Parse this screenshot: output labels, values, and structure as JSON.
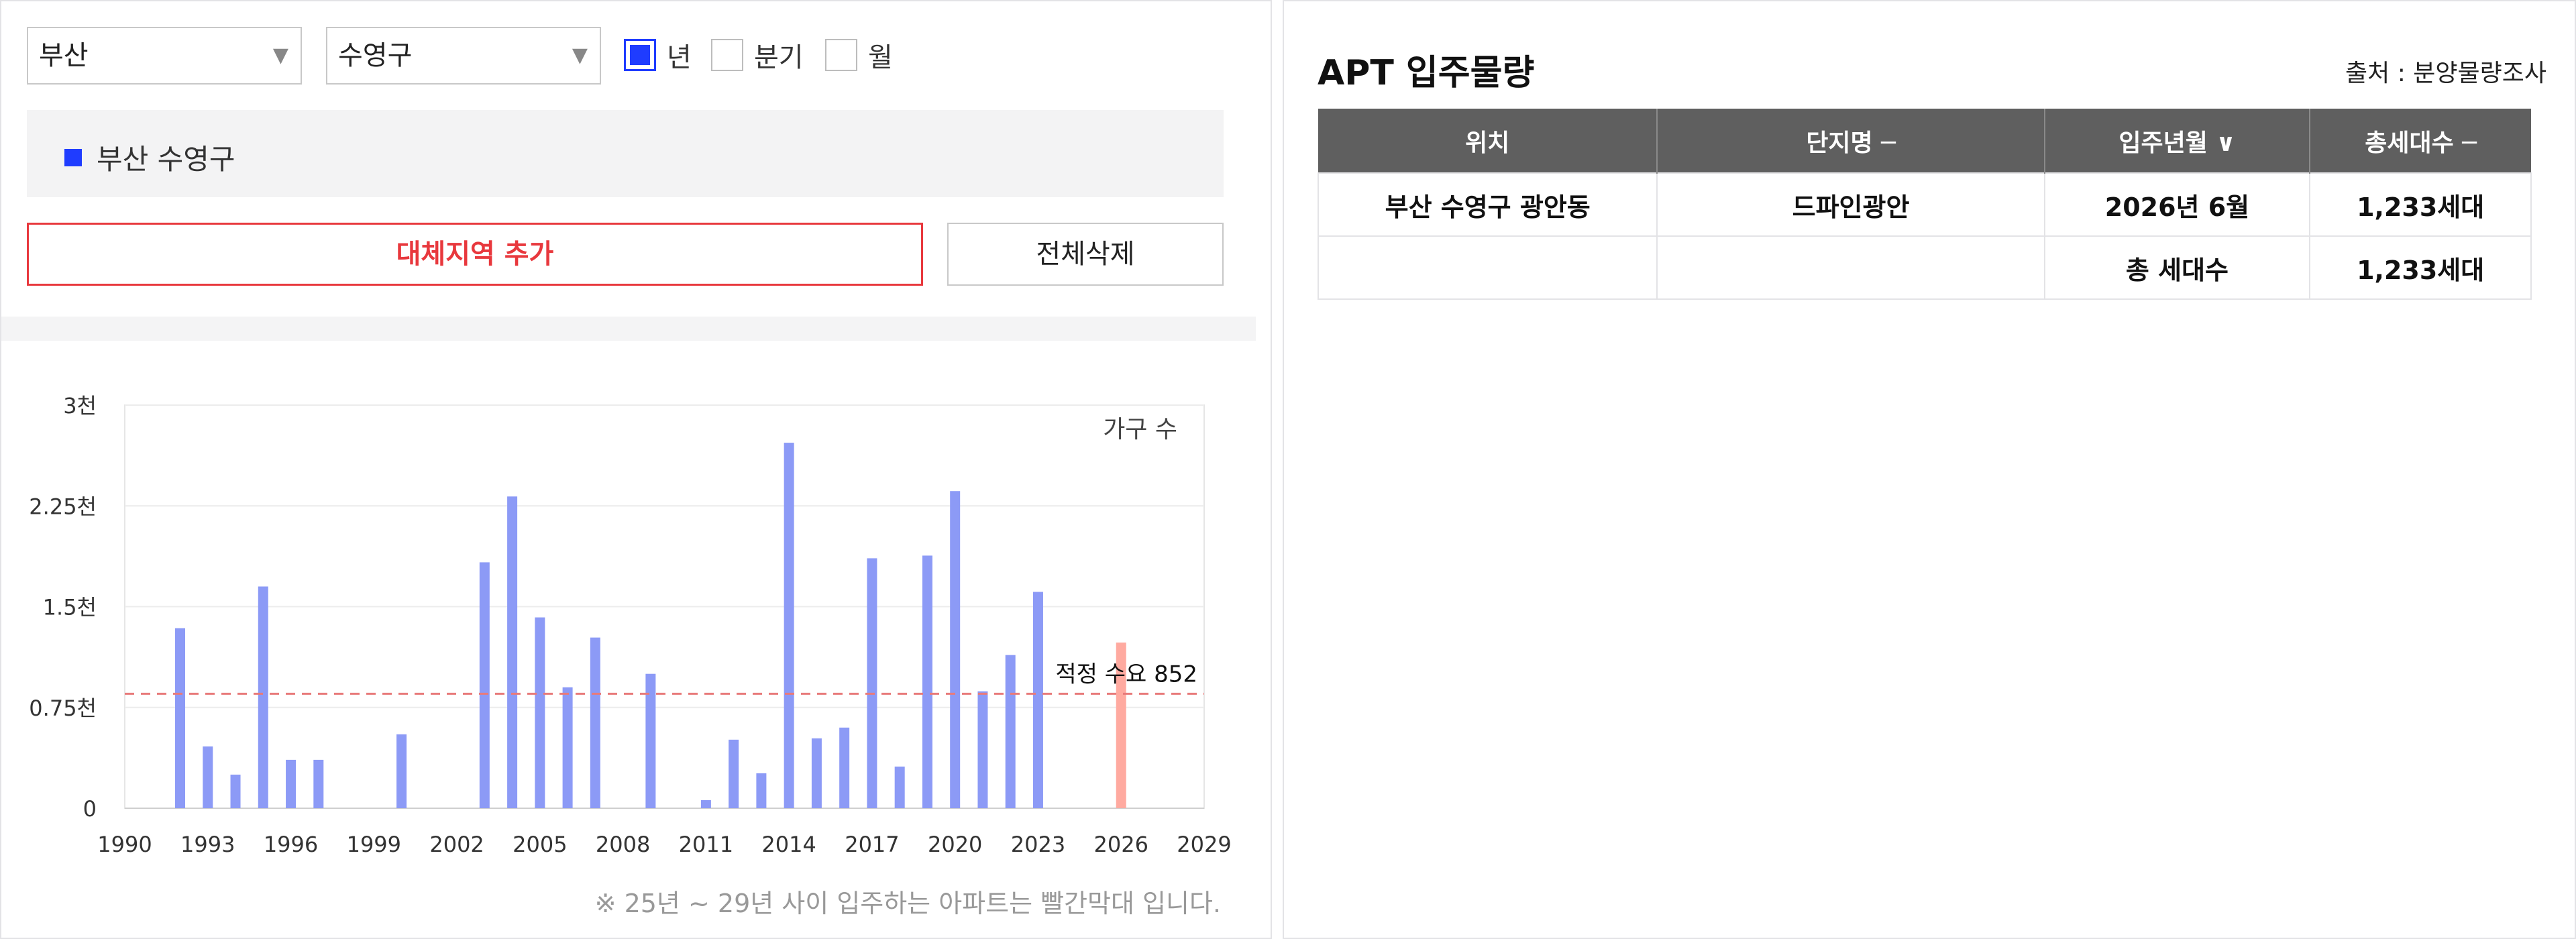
{
  "filters": {
    "province": "부산",
    "district": "수영구",
    "period_options": [
      {
        "label": "년",
        "checked": true
      },
      {
        "label": "분기",
        "checked": false
      },
      {
        "label": "월",
        "checked": false
      }
    ]
  },
  "region_list": {
    "items": [
      "부산 수영구"
    ],
    "color": "#1f3cff"
  },
  "buttons": {
    "add_region": "대체지역 추가",
    "delete_all": "전체삭제"
  },
  "chart_data": {
    "type": "bar",
    "title": "",
    "ylabel": "가구 수",
    "ylim": [
      0,
      3000
    ],
    "y_ticks": [
      {
        "value": 0,
        "label": "0"
      },
      {
        "value": 750,
        "label": "0.75천"
      },
      {
        "value": 1500,
        "label": "1.5천"
      },
      {
        "value": 2250,
        "label": "2.25천"
      },
      {
        "value": 3000,
        "label": "3천"
      }
    ],
    "xlim": [
      1990,
      2029
    ],
    "x_ticks": [
      1990,
      1993,
      1996,
      1999,
      2002,
      2005,
      2008,
      2011,
      2014,
      2017,
      2020,
      2023,
      2026,
      2029
    ],
    "series": [
      {
        "color": "#8c9af6",
        "points": [
          {
            "x": 1992,
            "y": 1340
          },
          {
            "x": 1993,
            "y": 460
          },
          {
            "x": 1994,
            "y": 250
          },
          {
            "x": 1995,
            "y": 1650
          },
          {
            "x": 1996,
            "y": 360
          },
          {
            "x": 1997,
            "y": 360
          },
          {
            "x": 2000,
            "y": 550
          },
          {
            "x": 2003,
            "y": 1830
          },
          {
            "x": 2004,
            "y": 2320
          },
          {
            "x": 2005,
            "y": 1420
          },
          {
            "x": 2006,
            "y": 900
          },
          {
            "x": 2007,
            "y": 1270
          },
          {
            "x": 2009,
            "y": 1000
          },
          {
            "x": 2011,
            "y": 60
          },
          {
            "x": 2012,
            "y": 510
          },
          {
            "x": 2013,
            "y": 260
          },
          {
            "x": 2014,
            "y": 2720
          },
          {
            "x": 2015,
            "y": 520
          },
          {
            "x": 2016,
            "y": 600
          },
          {
            "x": 2017,
            "y": 1860
          },
          {
            "x": 2018,
            "y": 310
          },
          {
            "x": 2019,
            "y": 1880
          },
          {
            "x": 2020,
            "y": 2360
          },
          {
            "x": 2021,
            "y": 870
          },
          {
            "x": 2022,
            "y": 1140
          },
          {
            "x": 2023,
            "y": 1610
          }
        ]
      },
      {
        "color": "#ffaaa0",
        "points": [
          {
            "x": 2026,
            "y": 1233
          }
        ]
      }
    ],
    "reference_line": {
      "label": "적정 수요 852",
      "value": 852,
      "color": "#e87b7b"
    },
    "grid": true,
    "note": "※ 25년 ~ 29년 사이 입주하는 아파트는 빨간막대 입니다."
  },
  "apt_panel": {
    "title": "APT 입주물량",
    "source": "출처 : 분양물량조사",
    "columns": [
      "위치",
      "단지명 ─",
      "입주년월 ∨",
      "총세대수 ─"
    ],
    "rows": [
      [
        "부산 수영구 광안동",
        "드파인광안",
        "2026년 6월",
        "1,233세대"
      ],
      [
        "",
        "",
        "총 세대수",
        "1,233세대"
      ]
    ]
  }
}
